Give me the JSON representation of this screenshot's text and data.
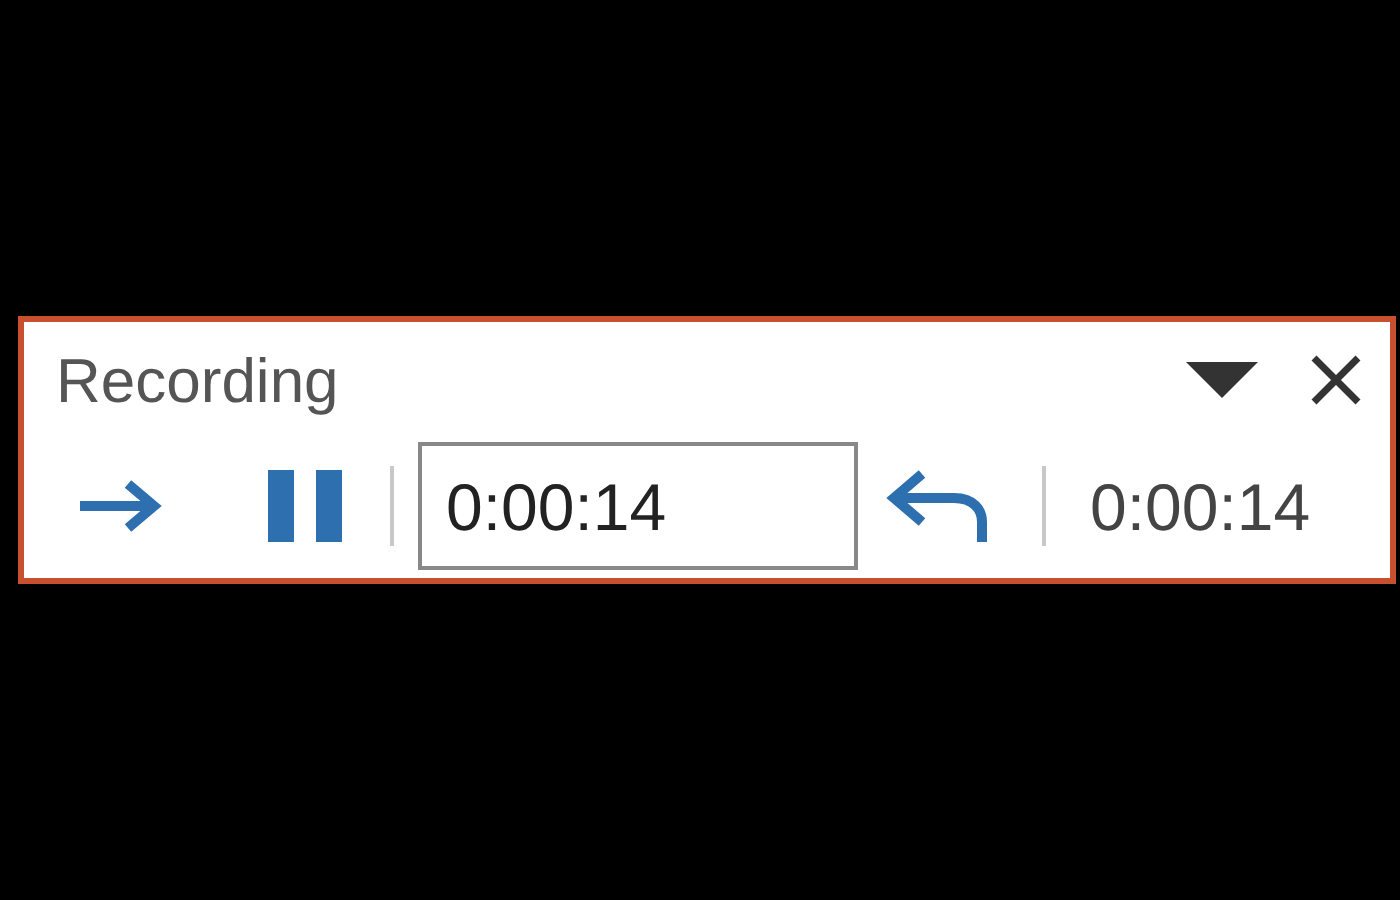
{
  "window": {
    "title": "Recording"
  },
  "time_field": {
    "value": "0:00:14"
  },
  "elapsed": "0:00:14"
}
